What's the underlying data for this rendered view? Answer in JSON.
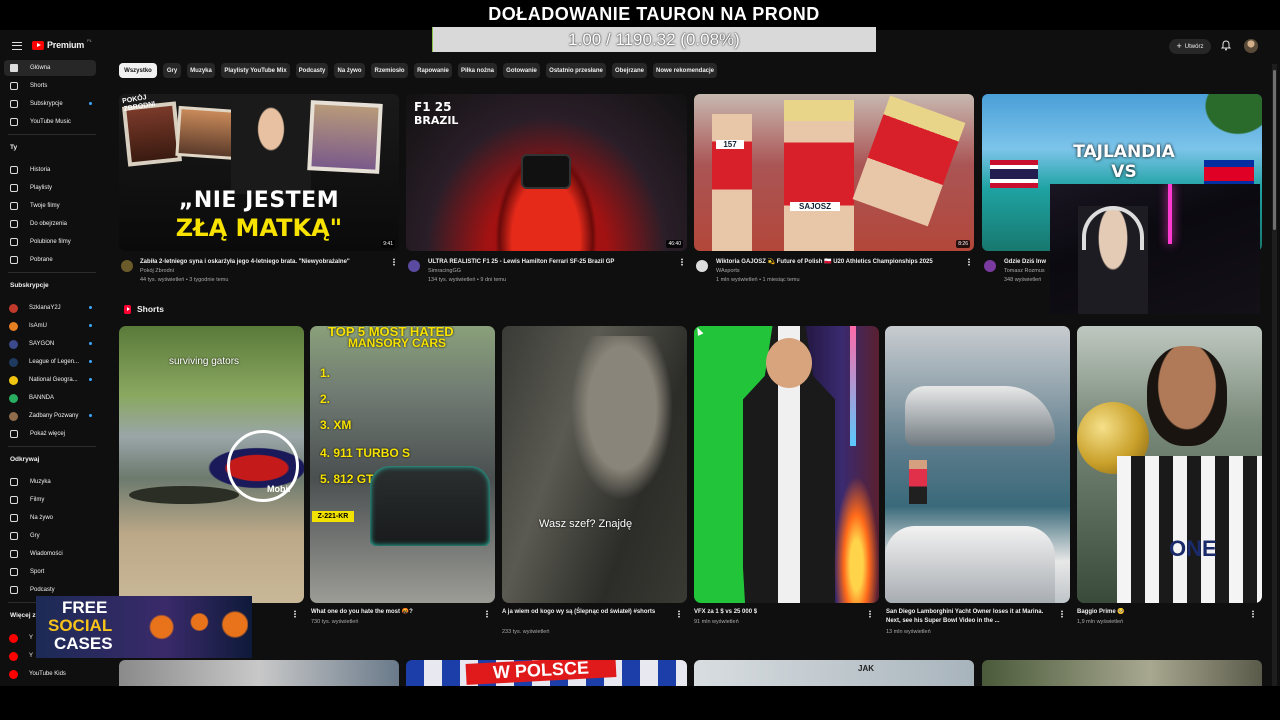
{
  "overlay": {
    "title": "DOŁADOWANIE TAURON NA PROND",
    "progress_text": "1.00 / 1190.32 (0.08%)",
    "progress_fraction": 0.0008
  },
  "topbar": {
    "logo_text": "Premium",
    "logo_suffix": "PL",
    "create_label": "Utwórz"
  },
  "sidebar": {
    "main": [
      {
        "label": "Główna",
        "icon": "home-icon",
        "active": true
      },
      {
        "label": "Shorts",
        "icon": "shorts-icon"
      },
      {
        "label": "Subskrypcje",
        "icon": "subscriptions-icon",
        "dot": true
      },
      {
        "label": "YouTube Music",
        "icon": "youtube-music-icon"
      }
    ],
    "you_header": "Ty",
    "you": [
      {
        "label": "Historia",
        "icon": "history-icon"
      },
      {
        "label": "Playlisty",
        "icon": "playlists-icon"
      },
      {
        "label": "Twoje filmy",
        "icon": "your-videos-icon"
      },
      {
        "label": "Do obejrzenia",
        "icon": "watch-later-icon"
      },
      {
        "label": "Polubione filmy",
        "icon": "liked-icon"
      },
      {
        "label": "Pobrane",
        "icon": "download-icon"
      }
    ],
    "subs_header": "Subskrypcje",
    "subs": [
      {
        "label": "SzklanaY2J",
        "color": "#c0392b",
        "dot": true
      },
      {
        "label": "IsAmU",
        "color": "#e67e22",
        "dot": true
      },
      {
        "label": "SAYGON",
        "color": "#3b4a8a",
        "dot": true
      },
      {
        "label": "League of Legen...",
        "color": "#1f3a5f",
        "dot": true
      },
      {
        "label": "National Geogra...",
        "color": "#f1c40f",
        "dot": true
      },
      {
        "label": "BANNDA",
        "color": "#27ae60",
        "dot": false
      },
      {
        "label": "Zadbany Pozwany",
        "color": "#8e6b4a",
        "dot": true
      },
      {
        "label": "Pokaż więcej",
        "icon": "chevron-down-icon"
      }
    ],
    "explore_header": "Odkrywaj",
    "explore": [
      {
        "label": "Muzyka",
        "icon": "music-icon"
      },
      {
        "label": "Filmy",
        "icon": "movies-icon"
      },
      {
        "label": "Na żywo",
        "icon": "live-icon"
      },
      {
        "label": "Gry",
        "icon": "gaming-icon"
      },
      {
        "label": "Wiadomości",
        "icon": "news-icon"
      },
      {
        "label": "Sport",
        "icon": "trophy-icon"
      },
      {
        "label": "Podcasty",
        "icon": "podcast-icon"
      }
    ],
    "more_header": "Więcej z",
    "more": [
      {
        "label": "Y",
        "color": "#ff0000"
      },
      {
        "label": "Y",
        "color": "#ff0000"
      },
      {
        "label": "YouTube Kids",
        "color": "#ff0000"
      }
    ]
  },
  "chips": [
    "Wszystko",
    "Gry",
    "Muzyka",
    "Playlisty YouTube Mix",
    "Podcasty",
    "Na żywo",
    "Rzemiosło",
    "Rapowanie",
    "Piłka nożna",
    "Gotowanie",
    "Ostatnio przesłane",
    "Obejrzane",
    "Nowe rekomendacje"
  ],
  "videos": [
    {
      "title": "Zabiła 2-letniego syna i oskarżyła jego 4-letniego brata. \"Niewyobrażalne\"",
      "channel": "Pokój Zbrodni",
      "meta": "44 tys. wyświetleń • 3 tygodnie temu",
      "duration": "9:41",
      "thumb_text": [
        "„NIE JESTEM",
        "ZŁĄ MATKĄ\""
      ],
      "thumb_badge": "POKÓJ ZBRODNI",
      "avatar_color": "#6b5a2a"
    },
    {
      "title": "ULTRA REALISTIC F1 25 - Lewis Hamilton Ferrari SF-25 Brazil GP",
      "channel": "SimracingGG",
      "meta": "134 tys. wyświetleń • 9 dni temu",
      "duration": "46:40",
      "thumb_text": [
        "F1 25",
        "BRAZIL"
      ],
      "avatar_color": "#5a4aa0"
    },
    {
      "title": "Wiktoria GAJOSZ 💫 Future of Polish 🇵🇱 U20 Athletics Championships 2025",
      "channel": "WAsports",
      "meta": "1 mln wyświetleń • 1 miesiąc temu",
      "duration": "8:26",
      "thumb_text": [
        "157",
        "SAJOSZ"
      ],
      "avatar_color": "#ddd"
    },
    {
      "title": "Gdzie Dziś Inw",
      "channel": "Tomasz Rozmus",
      "meta": "348 wyświetleń",
      "thumb_text": [
        "TAJLANDIA",
        "VS"
      ],
      "avatar_color": "#7a3aa0"
    }
  ],
  "shorts_header": "Shorts",
  "shorts": [
    {
      "title": "",
      "meta": "",
      "overlay": "surviving gators",
      "overlay2": "Mobil"
    },
    {
      "title": "What one do you hate the most 🤬?",
      "meta": "730 tys. wyświetleń",
      "overlay": "TOP 5 MOST HATED",
      "overlay2": "MANSORY CARS",
      "list": [
        "1.",
        "2.",
        "3. XM",
        "4. 911 TURBO S",
        "5. 812 GTS"
      ],
      "plate": "Z-221-KR"
    },
    {
      "title": "A ja wiem od kogo wy są (Ślepnąc od świateł) #shorts",
      "meta": "233 tys. wyświetleń",
      "overlay": "Wasz szef? Znajdę"
    },
    {
      "title": "VFX za 1 $ vs 25 000 $",
      "meta": "91 mln wyświetleń"
    },
    {
      "title": "San Diego Lamborghini Yacht Owner loses it at Marina. Next, see his Super Bowl Video in the ...",
      "meta": "13 mln wyświetleń"
    },
    {
      "title": "Baggio Prime 🥺",
      "meta": "1,9 mln wyświetleń",
      "overlay": "ONE"
    }
  ],
  "bottom_row": {
    "thumb2_text": "W POLSCE",
    "thumb3_text": "JAK"
  },
  "promo": {
    "line1": "FREE",
    "line2": "SOCIAL",
    "line3": "CASES"
  }
}
